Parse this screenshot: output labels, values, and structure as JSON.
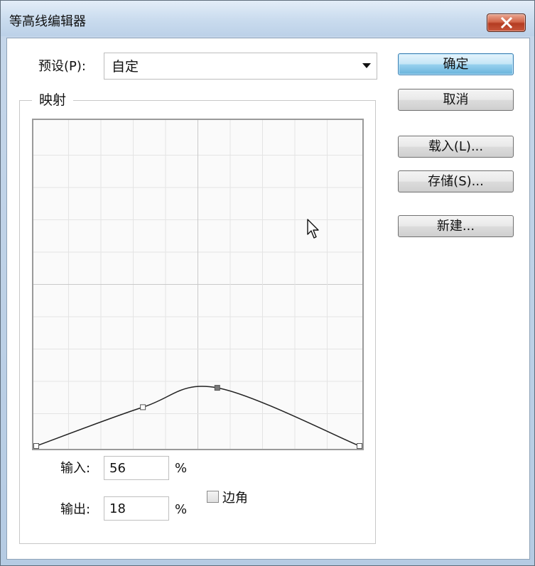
{
  "window": {
    "title": "等高线编辑器"
  },
  "preset": {
    "label": "预设(P):",
    "value": "自定"
  },
  "mapping": {
    "legend": "映射",
    "curve_points": [
      {
        "input": 0,
        "output": 0
      },
      {
        "input": 33,
        "output": 12
      },
      {
        "input": 56,
        "output": 18
      },
      {
        "input": 100,
        "output": 0
      }
    ],
    "grid_divisions": 10
  },
  "io": {
    "input_label": "输入:",
    "input_value": "56",
    "output_label": "输出:",
    "output_value": "18",
    "percent": "%",
    "corner_label": "边角",
    "corner_checked": false
  },
  "buttons": {
    "ok": "确定",
    "cancel": "取消",
    "load": "载入(L)...",
    "save": "存储(S)...",
    "new": "新建..."
  },
  "colors": {
    "title_bg": "#c9dbee",
    "close_red": "#c8563b",
    "default_btn": "#98d1ef"
  }
}
